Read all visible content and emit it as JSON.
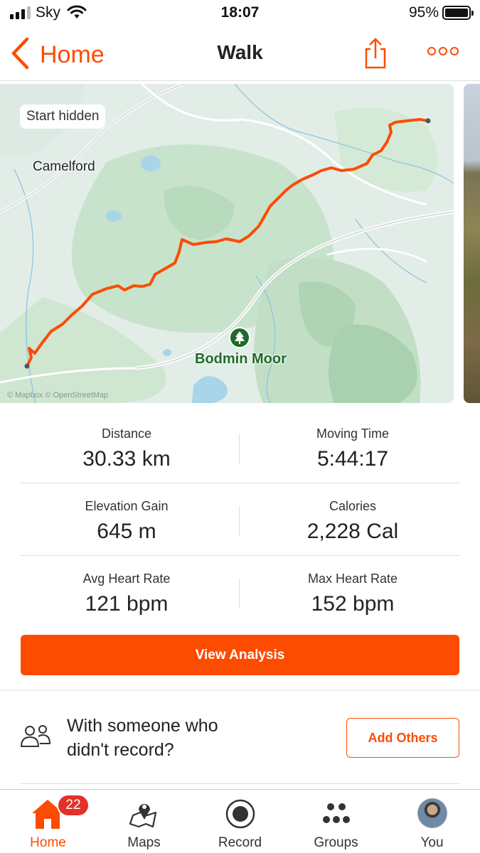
{
  "status_bar": {
    "carrier": "Sky",
    "time": "18:07",
    "battery": "95%",
    "battery_level": 0.95,
    "icons": [
      "signal-icon",
      "wifi-icon",
      "battery-icon"
    ]
  },
  "nav": {
    "back_label": "Home",
    "title": "Walk",
    "icons": [
      "chevron-left-icon",
      "share-icon",
      "more-icon"
    ]
  },
  "map": {
    "start_hidden": "Start hidden",
    "places": {
      "camelford": "Camelford",
      "bodmin_moor": "Bodmin Moor"
    },
    "attribution": "© Mapbox © OpenStreetMap",
    "route_color": "#fc4c02",
    "icons": [
      "tree-icon"
    ]
  },
  "stats": [
    {
      "label": "Distance",
      "value": "30.33 km"
    },
    {
      "label": "Moving Time",
      "value": "5:44:17"
    },
    {
      "label": "Elevation Gain",
      "value": "645 m"
    },
    {
      "label": "Calories",
      "value": "2,228 Cal"
    },
    {
      "label": "Avg Heart Rate",
      "value": "121 bpm"
    },
    {
      "label": "Max Heart Rate",
      "value": "152 bpm"
    }
  ],
  "analysis_button": "View Analysis",
  "with_someone": {
    "line1": "With someone who",
    "line2": "didn't record?",
    "button": "Add Others",
    "icon": "people-icon"
  },
  "tabs": [
    {
      "label": "Home",
      "icon": "home-icon",
      "active": true,
      "badge": "22"
    },
    {
      "label": "Maps",
      "icon": "maps-icon",
      "active": false
    },
    {
      "label": "Record",
      "icon": "record-icon",
      "active": false
    },
    {
      "label": "Groups",
      "icon": "groups-icon",
      "active": false
    },
    {
      "label": "You",
      "icon": "avatar",
      "active": false
    }
  ],
  "colors": {
    "accent": "#fc4c02",
    "badge": "#e3312a",
    "map_green": "#1e6b27"
  }
}
